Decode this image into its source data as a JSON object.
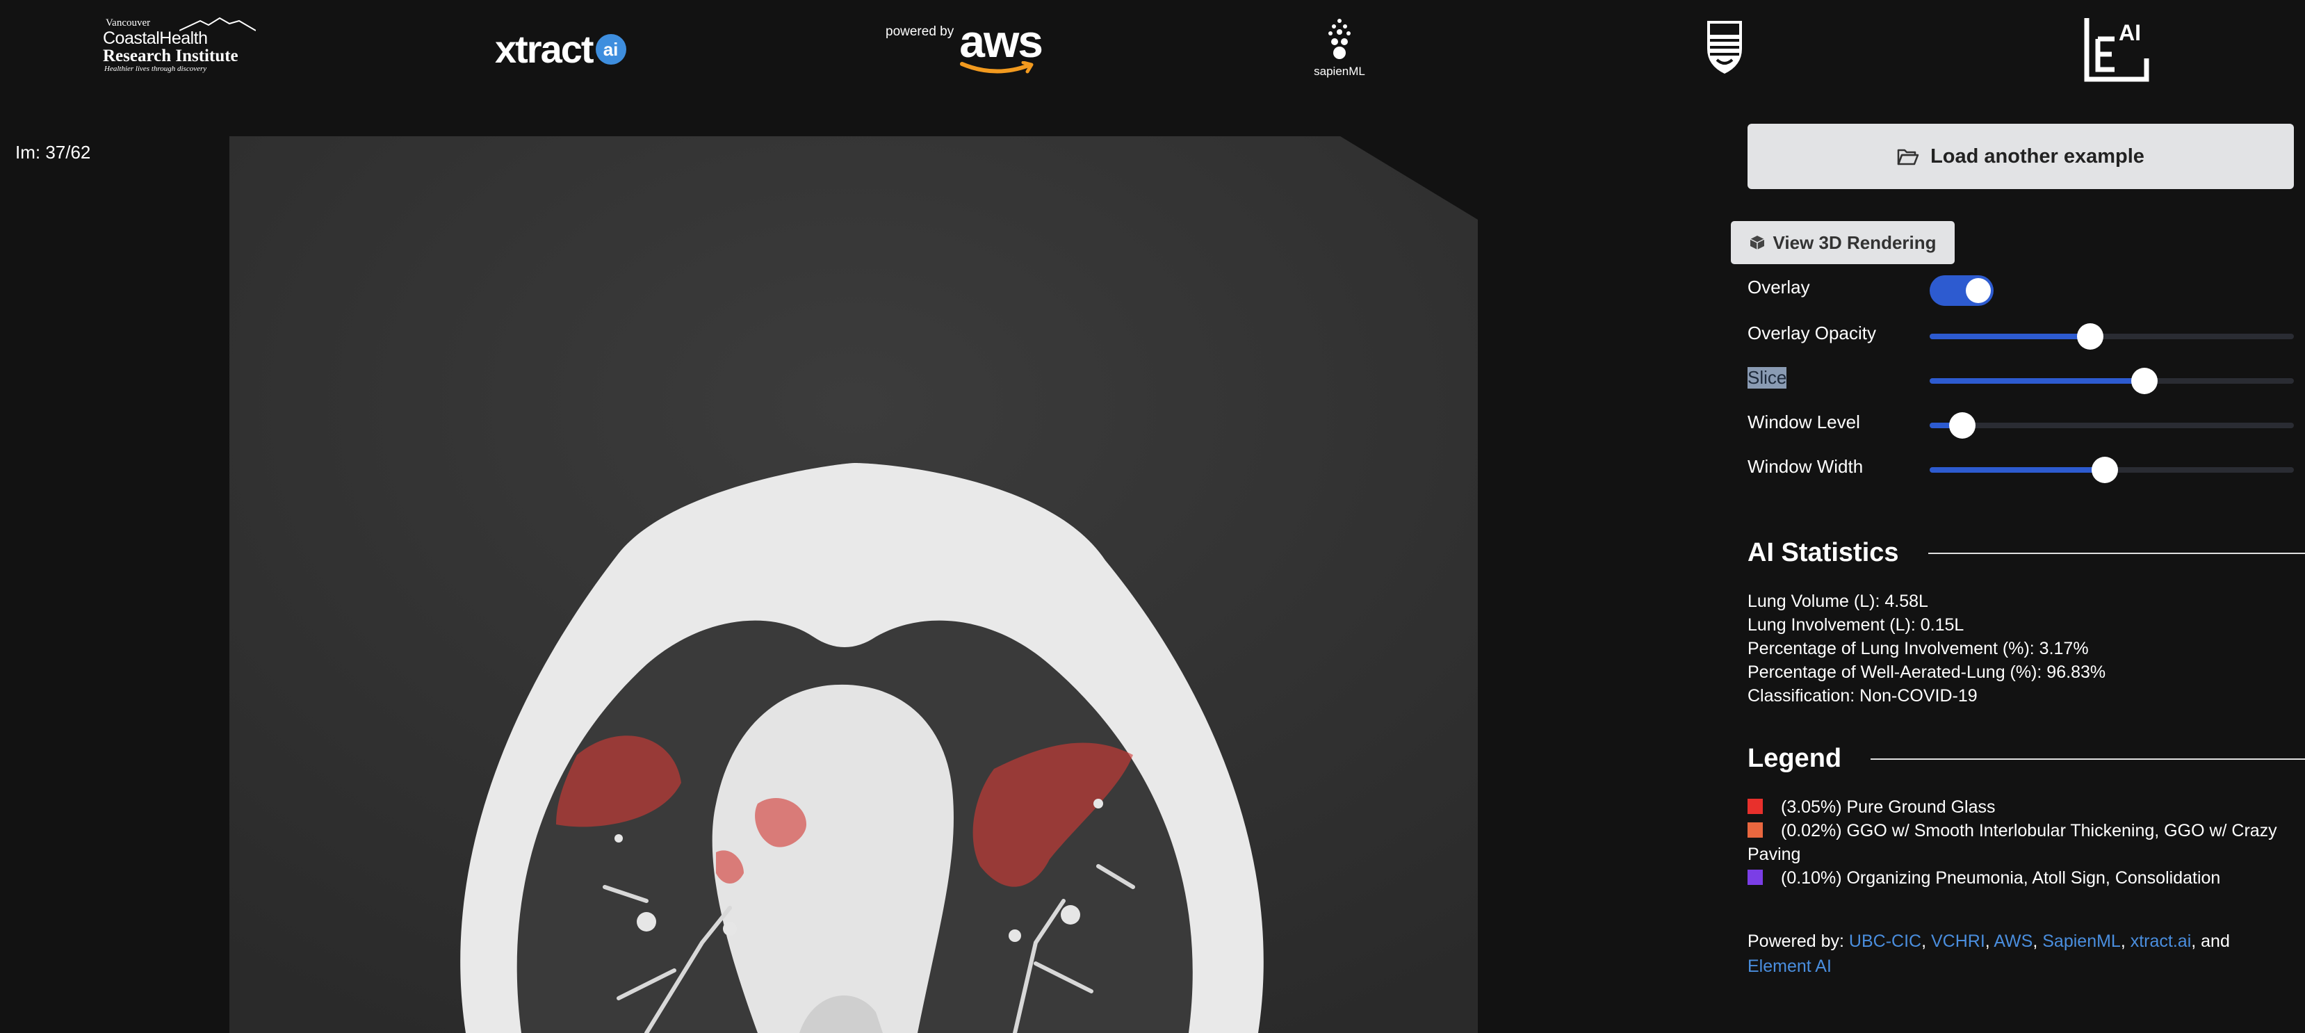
{
  "logos": {
    "vch": {
      "line1": "Vancouver",
      "line2": "CoastalHealth",
      "line3": "Research Institute",
      "tagline": "Healthier lives through discovery"
    },
    "xtract": {
      "name": "xtract",
      "badge": "ai"
    },
    "aws": {
      "powered_by": "powered by",
      "word": "aws"
    },
    "sapien": {
      "name": "sapienML"
    },
    "ubc": {
      "name": "UBC"
    },
    "eai": {
      "letter": "E",
      "sup": "AI"
    }
  },
  "viewer": {
    "image_index": "Im: 37/62"
  },
  "controls": {
    "load_button": "Load another example",
    "view3d_button": "View 3D Rendering",
    "overlay": {
      "label": "Overlay",
      "on": true
    },
    "opacity": {
      "label": "Overlay Opacity",
      "value": 0.44
    },
    "slice": {
      "label": "Slice",
      "value": 0.59
    },
    "window_level": {
      "label": "Window Level",
      "value": 0.09
    },
    "window_width": {
      "label": "Window Width",
      "value": 0.48
    }
  },
  "stats": {
    "title": "AI Statistics",
    "lines": [
      "Lung Volume (L): 4.58L",
      "Lung Involvement (L): 0.15L",
      "Percentage of Lung Involvement (%): 3.17%",
      "Percentage of Well-Aerated-Lung (%): 96.83%",
      "Classification: Non-COVID-19"
    ]
  },
  "legend": {
    "title": "Legend",
    "items": [
      {
        "color": "#e8302c",
        "text": "(3.05%) Pure Ground Glass"
      },
      {
        "color": "#e9673f",
        "text": "(0.02%) GGO w/ Smooth Interlobular Thickening, GGO w/ Crazy Paving"
      },
      {
        "color": "#7b3ee6",
        "text": "(0.10%) Organizing Pneumonia, Atoll Sign, Consolidation"
      }
    ]
  },
  "powered": {
    "prefix": "Powered by: ",
    "links": [
      "UBC-CIC",
      "VCHRI",
      "AWS",
      "SapienML",
      "xtract.ai"
    ],
    "and": ", and",
    "last": "Element AI"
  },
  "colors": {
    "accent": "#2d5bd0",
    "link": "#4a8ede",
    "overlay_red": "#e8302c"
  },
  "icons": {
    "load": "folder-open-icon",
    "view3d": "cube-icon"
  }
}
